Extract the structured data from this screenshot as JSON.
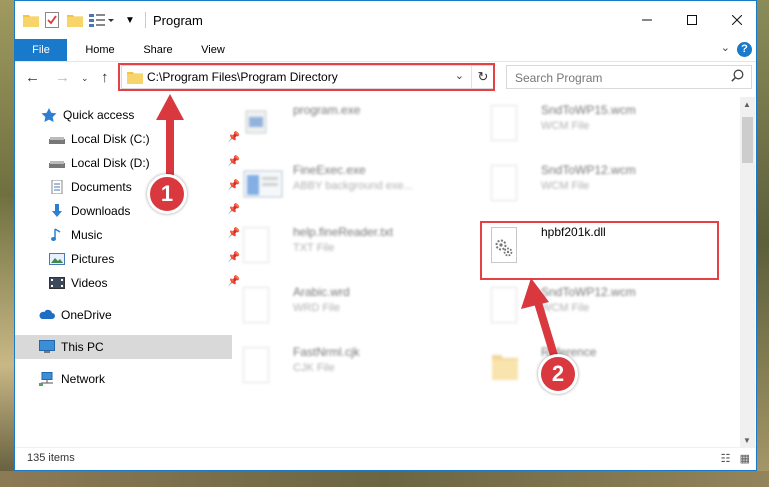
{
  "window": {
    "title": "Program",
    "minimize_icon": "minimize-icon",
    "maximize_icon": "maximize-icon",
    "close_icon": "close-icon"
  },
  "ribbon": {
    "tabs": [
      "File",
      "Home",
      "Share",
      "View"
    ],
    "help_label": "?"
  },
  "address": {
    "path": "C:\\Program Files\\Program Directory"
  },
  "search": {
    "placeholder": "Search Program"
  },
  "sidebar": {
    "items": [
      {
        "label": "Quick access",
        "icon": "star-icon",
        "pinned": false
      },
      {
        "label": "Local Disk (C:)",
        "icon": "drive-icon",
        "pinned": true
      },
      {
        "label": "Local Disk (D:)",
        "icon": "drive-icon",
        "pinned": true
      },
      {
        "label": "Documents",
        "icon": "documents-icon",
        "pinned": true
      },
      {
        "label": "Downloads",
        "icon": "downloads-icon",
        "pinned": true
      },
      {
        "label": "Music",
        "icon": "music-icon",
        "pinned": true
      },
      {
        "label": "Pictures",
        "icon": "pictures-icon",
        "pinned": true
      },
      {
        "label": "Videos",
        "icon": "videos-icon",
        "pinned": true
      },
      {
        "label": "OneDrive",
        "icon": "cloud-icon",
        "pinned": false
      },
      {
        "label": "This PC",
        "icon": "computer-icon",
        "pinned": false,
        "selected": true
      },
      {
        "label": "Network",
        "icon": "network-icon",
        "pinned": false
      }
    ]
  },
  "files": [
    {
      "name": "program.exe",
      "type": ""
    },
    {
      "name": "FineExec.exe",
      "type": "ABBY background exe..."
    },
    {
      "name": "help.fineReader.txt",
      "type": "TXT File"
    },
    {
      "name": "Arabic.wrd",
      "type": "WRD File"
    },
    {
      "name": "FastNrml.cjk",
      "type": "CJK File"
    },
    {
      "name": "SndToWP15.wcm",
      "type": "WCM File"
    },
    {
      "name": "SndToWP12.wcm",
      "type": "WCM File"
    },
    {
      "name": "hpbf201k.dll",
      "type": ""
    },
    {
      "name": "SndToWP12.wcm",
      "type": "WCM File"
    },
    {
      "name": "Reference",
      "type": ""
    }
  ],
  "status": {
    "item_count": "135 items"
  },
  "callouts": [
    "1",
    "2"
  ],
  "colors": {
    "accent": "#1979ca",
    "highlight": "#e54046",
    "callout": "#d9383e"
  }
}
